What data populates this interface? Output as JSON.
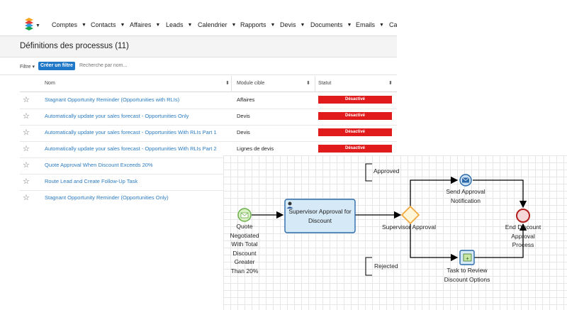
{
  "nav": {
    "items": [
      "Comptes",
      "Contacts",
      "Affaires",
      "Leads",
      "Calendrier",
      "Rapports",
      "Devis",
      "Documents",
      "Emails",
      "Ca"
    ],
    "logo_icon": "sugar-cube-logo"
  },
  "page": {
    "title": "Définitions des processus (11)"
  },
  "filter": {
    "label": "Filtre ▾",
    "create_button": "Créer un filtre",
    "search_placeholder": "Recherche par nom..."
  },
  "table": {
    "headers": {
      "name": "Nom",
      "module": "Module cible",
      "status": "Statut"
    },
    "rows": [
      {
        "name": "Stagnant Opportunity Reminder (Opportunities with RLIs)",
        "module": "Affaires",
        "status": "Désactivé"
      },
      {
        "name": "Automatically update your sales forecast - Opportunities Only",
        "module": "Devis",
        "status": "Désactivé"
      },
      {
        "name": "Automatically update your sales forecast - Opportunities With RLIs Part 1",
        "module": "Devis",
        "status": "Désactivé"
      },
      {
        "name": "Automatically update your sales forecast - Opportunities With RLIs Part 2",
        "module": "Lignes de devis",
        "status": "Désactivé"
      },
      {
        "name": "Quote Approval When Discount Exceeds 20%",
        "module": "",
        "status": ""
      },
      {
        "name": "Route Lead and Create Follow-Up Task",
        "module": "",
        "status": ""
      },
      {
        "name": "Stagnant Opportunity Reminder (Opportunities Only)",
        "module": "",
        "status": ""
      }
    ]
  },
  "diagram": {
    "start_event": "Quote Negotiated With Total Discount Greater Than 20%",
    "approval_task": "Supervisor Approval for Discount",
    "gateway": "Supervisor Approval",
    "approved_label": "Approved",
    "rejected_label": "Rejected",
    "send_notification": "Send Approval Notification",
    "review_task": "Task to Review Discount Options",
    "end_event": "End Discount Approval Process"
  },
  "colors": {
    "link": "#2b7bc0",
    "status_red": "#e11b1b",
    "primary": "#1f78c8",
    "task_fill": "#d6e9f7",
    "gateway": "#f2a93b"
  }
}
